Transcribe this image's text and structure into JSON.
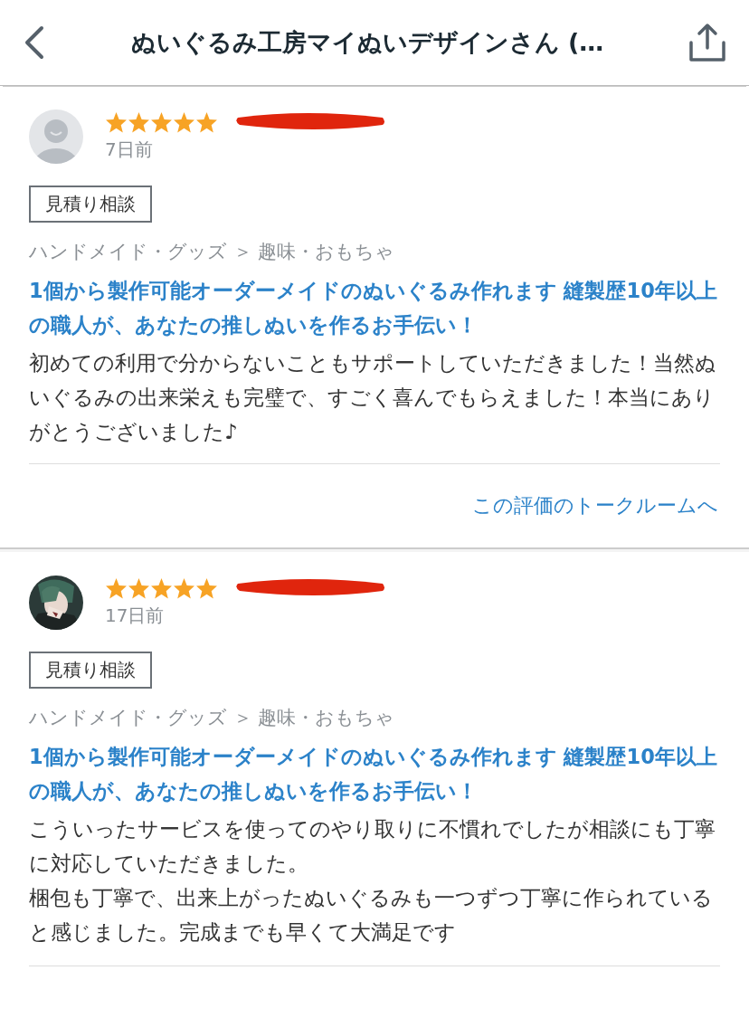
{
  "header": {
    "title": "ぬいぐるみ工房マイぬいデザインさん (…"
  },
  "reviews": [
    {
      "avatar": {
        "kind": "default"
      },
      "stars": 5,
      "date": "7日前",
      "tag": "見積り相談",
      "category": "ハンドメイド・グッズ ＞ 趣味・おもちゃ",
      "service_title": "1個から製作可能オーダーメイドのぬいぐるみ作れます 縫製歴10年以上の職人が、あなたの推しぬいを作るお手伝い！",
      "comment": [
        "初めての利用で分からないこともサポートしていただきました！当然ぬいぐるみの出来栄えも完璧で、すごく喜んでもらえました！本当にありがとうございました♪"
      ],
      "link": "この評価のトークルームへ"
    },
    {
      "stars": 5,
      "date": "17日前",
      "tag": "見積り相談",
      "category": "ハンドメイド・グッズ ＞ 趣味・おもちゃ",
      "service_title": "1個から製作可能オーダーメイドのぬいぐるみ作れます 縫製歴10年以上の職人が、あなたの推しぬいを作るお手伝い！",
      "comment": [
        "こういったサービスを使ってのやり取りに不慣れでしたが相談にも丁寧に対応していただきました。",
        "梱包も丁寧で、出来上がったぬいぐるみも一つずつ丁寧に作られていると感じました。完成までも早くて大満足です"
      ]
    }
  ]
}
